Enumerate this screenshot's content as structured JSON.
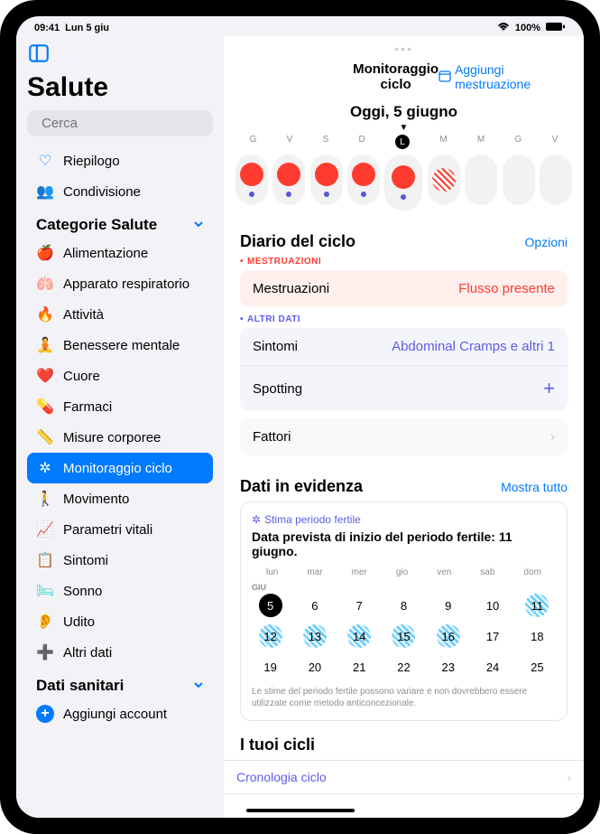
{
  "status": {
    "time": "09:41",
    "date": "Lun 5 giu",
    "battery": "100%"
  },
  "app_title": "Salute",
  "search": {
    "placeholder": "Cerca"
  },
  "nav_main": [
    {
      "label": "Riepilogo",
      "icon": "♡",
      "color": "#007aff"
    },
    {
      "label": "Condivisione",
      "icon": "👥",
      "color": "#007aff"
    }
  ],
  "section_categories": "Categorie Salute",
  "categories": [
    {
      "label": "Alimentazione",
      "color": "#34c759"
    },
    {
      "label": "Apparato respiratorio",
      "color": "#5ac8fa"
    },
    {
      "label": "Attività",
      "color": "#ff9500"
    },
    {
      "label": "Benessere mentale",
      "color": "#a2d2c9"
    },
    {
      "label": "Cuore",
      "color": "#ff3b30"
    },
    {
      "label": "Farmaci",
      "color": "#5ac8fa"
    },
    {
      "label": "Misure corporee",
      "color": "#af52de"
    },
    {
      "label": "Monitoraggio ciclo",
      "color": "#5e5ce6",
      "active": true
    },
    {
      "label": "Movimento",
      "color": "#ff9500"
    },
    {
      "label": "Parametri vitali",
      "color": "#ff3b30"
    },
    {
      "label": "Sintomi",
      "color": "#5e5ce6"
    },
    {
      "label": "Sonno",
      "color": "#30d5c8"
    },
    {
      "label": "Udito",
      "color": "#007aff"
    },
    {
      "label": "Altri dati",
      "color": "#007aff"
    }
  ],
  "section_health_data": "Dati sanitari",
  "health_data_items": [
    {
      "label": "Aggiungi account",
      "icon": "+"
    }
  ],
  "main": {
    "header_title": "Monitoraggio ciclo",
    "header_btn": "Aggiungi mestruazione",
    "today_label": "Oggi, 5 giugno",
    "week_letters": [
      "G",
      "V",
      "S",
      "D",
      "L",
      "M",
      "M",
      "G",
      "V"
    ],
    "today_index": 4,
    "ovals": [
      {
        "flow": "red",
        "purple": true
      },
      {
        "flow": "red",
        "purple": true
      },
      {
        "flow": "red",
        "purple": true
      },
      {
        "flow": "red",
        "purple": true
      },
      {
        "flow": "red",
        "purple": true,
        "today": true
      },
      {
        "flow": "hatch",
        "purple": false
      },
      {
        "flow": "",
        "purple": false
      },
      {
        "flow": "",
        "purple": false
      },
      {
        "flow": "",
        "purple": false
      }
    ],
    "diary": {
      "title": "Diario del ciclo",
      "options": "Opzioni",
      "tag_menstruation": "Mestruazioni",
      "row_menstruation_label": "Mestruazioni",
      "row_menstruation_value": "Flusso presente",
      "tag_other": "Altri dati",
      "row_symptoms_label": "Sintomi",
      "row_symptoms_value": "Abdominal Cramps e altri 1",
      "row_spotting_label": "Spotting",
      "row_factors_label": "Fattori"
    },
    "highlights": {
      "title": "Dati in evidenza",
      "show_all": "Mostra tutto",
      "sub": "Stima periodo fertile",
      "card_title": "Data prevista di inizio del periodo fertile: 11 giugno.",
      "week_days": [
        "lun",
        "mar",
        "mer",
        "gio",
        "ven",
        "sab",
        "dom"
      ],
      "month": "GIU",
      "grid": [
        {
          "n": 5,
          "today": true
        },
        {
          "n": 6
        },
        {
          "n": 7
        },
        {
          "n": 8
        },
        {
          "n": 9
        },
        {
          "n": 10
        },
        {
          "n": 11,
          "fertile": true
        },
        {
          "n": 12,
          "fertile": true
        },
        {
          "n": 13,
          "fertile": true
        },
        {
          "n": 14,
          "fertile": true
        },
        {
          "n": 15,
          "fertile": true
        },
        {
          "n": 16,
          "fertile": true
        },
        {
          "n": 17
        },
        {
          "n": 18
        },
        {
          "n": 19
        },
        {
          "n": 20
        },
        {
          "n": 21
        },
        {
          "n": 22
        },
        {
          "n": 23
        },
        {
          "n": 24
        },
        {
          "n": 25
        }
      ],
      "note": "Le stime del periodo fertile possono variare e non dovrebbero essere utilizzate come metodo anticoncezionale."
    },
    "cycles": {
      "title": "I tuoi cicli",
      "link": "Cronologia ciclo"
    }
  }
}
